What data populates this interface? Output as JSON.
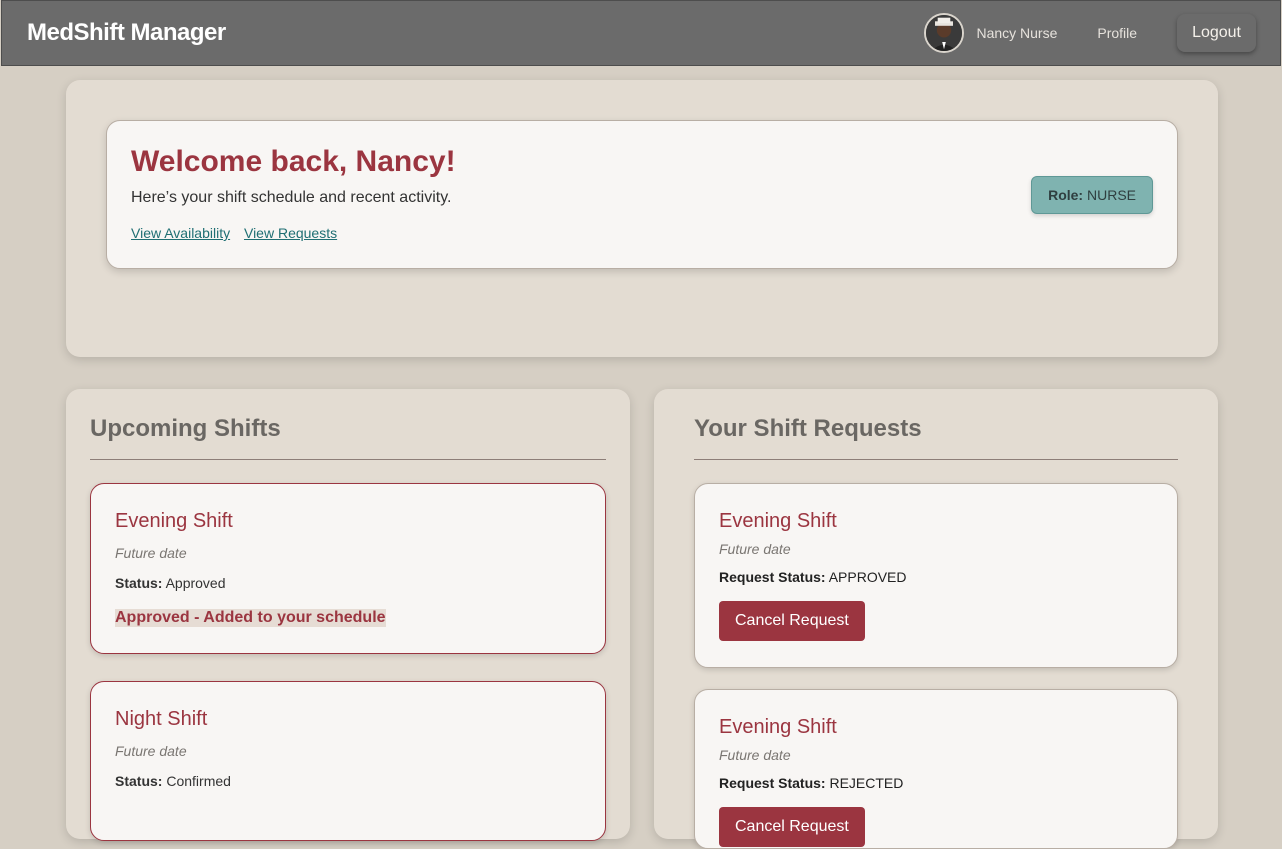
{
  "navbar": {
    "brand": "MedShift Manager",
    "user_name": "Nancy Nurse",
    "profile_label": "Profile",
    "logout_label": "Logout"
  },
  "welcome": {
    "title": "Welcome back, Nancy!",
    "subtitle": "Here’s your shift schedule and recent activity.",
    "links": [
      "View Availability",
      "View Requests"
    ],
    "role_label": "Role:",
    "role_value": "NURSE"
  },
  "upcoming": {
    "title": "Upcoming Shifts",
    "status_label": "Status:",
    "shifts": [
      {
        "name": "Evening Shift",
        "date": "Future date",
        "status": "Approved",
        "note": "Approved - Added to your schedule"
      },
      {
        "name": "Night Shift",
        "date": "Future date",
        "status": "Confirmed"
      }
    ]
  },
  "requests": {
    "title": "Your Shift Requests",
    "status_label": "Request Status:",
    "cancel_label": "Cancel Request",
    "items": [
      {
        "name": "Evening Shift",
        "date": "Future date",
        "status": "APPROVED"
      },
      {
        "name": "Evening Shift",
        "date": "Future date",
        "status": "REJECTED"
      }
    ]
  },
  "colors": {
    "accent": "#9b3540",
    "navbar": "#6b6b6b",
    "role_badge": "#7fb3b0",
    "link": "#1f6f73"
  }
}
